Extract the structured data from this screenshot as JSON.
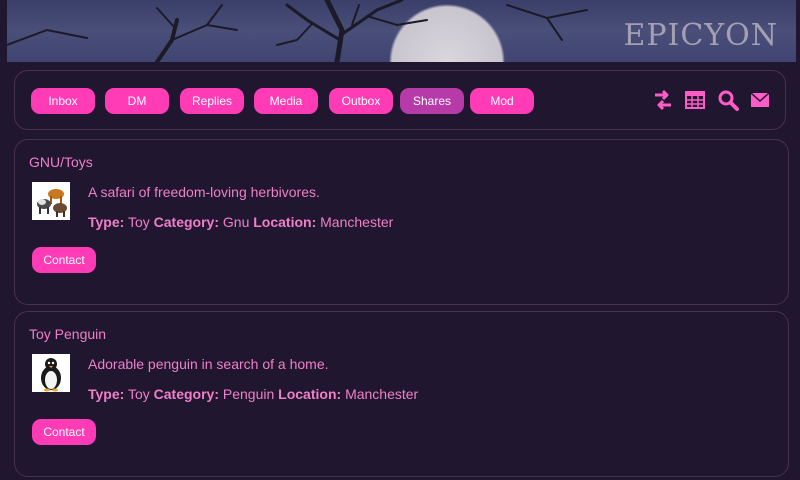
{
  "banner": {
    "title": "EPICYON"
  },
  "nav": {
    "buttons": [
      {
        "label": "Inbox",
        "active": false
      },
      {
        "label": "DM",
        "active": false
      },
      {
        "label": "Replies",
        "active": false
      },
      {
        "label": "Media",
        "active": false
      },
      {
        "label": "Outbox",
        "active": false
      },
      {
        "label": "Shares",
        "active": true
      },
      {
        "label": "Mod",
        "active": false
      }
    ],
    "icons": [
      "swap-icon",
      "calendar-grid-icon",
      "search-icon",
      "mail-icon"
    ]
  },
  "shares": [
    {
      "title": "GNU/Toys",
      "description": "A safari of freedom-loving herbivores.",
      "type_label": "Type:",
      "type": "Toy",
      "category_label": "Category:",
      "category": "Gnu",
      "location_label": "Location:",
      "location": "Manchester",
      "contact_label": "Contact"
    },
    {
      "title": "Toy Penguin",
      "description": "Adorable penguin in search of a home.",
      "type_label": "Type:",
      "type": "Toy",
      "category_label": "Category:",
      "category": "Penguin",
      "location_label": "Location:",
      "location": "Manchester",
      "contact_label": "Contact"
    }
  ],
  "colors": {
    "background": "#201630",
    "accent": "#ff3cb5",
    "active": "#b63ba8",
    "text": "#f07fc9"
  }
}
